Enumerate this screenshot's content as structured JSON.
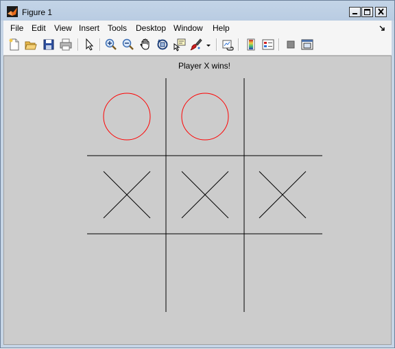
{
  "window": {
    "title": "Figure 1"
  },
  "menubar": {
    "items": [
      {
        "label": "File"
      },
      {
        "label": "Edit"
      },
      {
        "label": "View"
      },
      {
        "label": "Insert"
      },
      {
        "label": "Tools"
      },
      {
        "label": "Desktop"
      },
      {
        "label": "Window"
      },
      {
        "label": "Help"
      }
    ]
  },
  "toolbar": {
    "buttons": [
      {
        "icon": "new-figure-icon"
      },
      {
        "icon": "open-file-icon"
      },
      {
        "icon": "save-icon"
      },
      {
        "icon": "print-icon"
      },
      {
        "icon": "edit-plot-arrow-icon"
      },
      {
        "icon": "zoom-in-icon"
      },
      {
        "icon": "zoom-out-icon"
      },
      {
        "icon": "pan-hand-icon"
      },
      {
        "icon": "rotate-3d-icon"
      },
      {
        "icon": "data-cursor-icon"
      },
      {
        "icon": "brush-icon"
      },
      {
        "icon": "brush-dropdown-icon"
      },
      {
        "icon": "link-plot-icon"
      },
      {
        "icon": "insert-colorbar-icon"
      },
      {
        "icon": "insert-legend-icon"
      },
      {
        "icon": "hide-plot-tools-icon"
      },
      {
        "icon": "show-plot-tools-icon"
      }
    ]
  },
  "figure": {
    "status_text": "Player X wins!"
  },
  "board": {
    "cells": [
      [
        "O",
        "O",
        ""
      ],
      [
        "X",
        "X",
        "X"
      ],
      [
        "",
        "",
        ""
      ]
    ],
    "colors": {
      "grid": "#000000",
      "o_mark": "#ff0000",
      "x_mark": "#000000",
      "background": "#cccccc"
    }
  }
}
